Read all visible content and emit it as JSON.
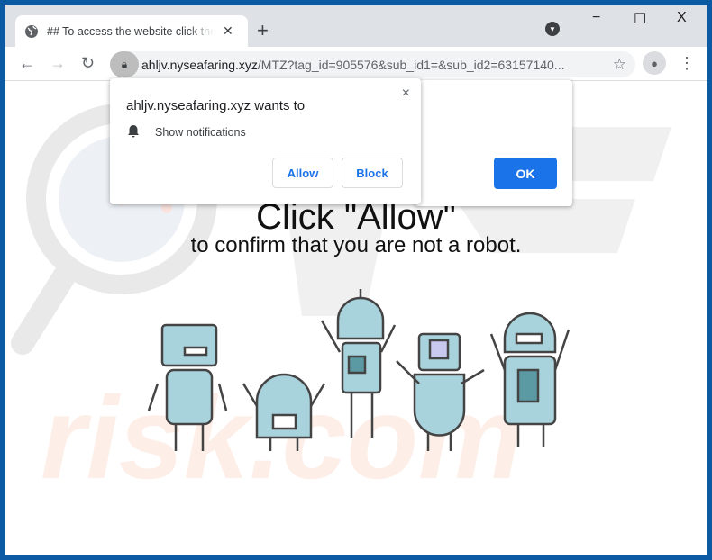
{
  "browser": {
    "tab_title": "## To access the website click the button",
    "new_tab": "+",
    "url_host": "ahljv.nyseafaring.xyz",
    "url_path": "/MTZ?tag_id=905576&sub_id1=&sub_id2=63157140...",
    "window_controls": {
      "minimize": "−",
      "maximize": "☐",
      "close": "X"
    }
  },
  "permission_popup": {
    "title": "ahljv.nyseafaring.xyz wants to",
    "permission": "Show notifications",
    "allow": "Allow",
    "block": "Block",
    "close": "×"
  },
  "dialog": {
    "ok": "OK"
  },
  "page": {
    "heading": "Click \"Allow\"",
    "subheading": "to confirm that you are not a robot.",
    "watermark": "PCrisk.com"
  },
  "colors": {
    "accent": "#1a73e8",
    "frame": "#0b5aa3",
    "robot": "#a9d3dc"
  }
}
